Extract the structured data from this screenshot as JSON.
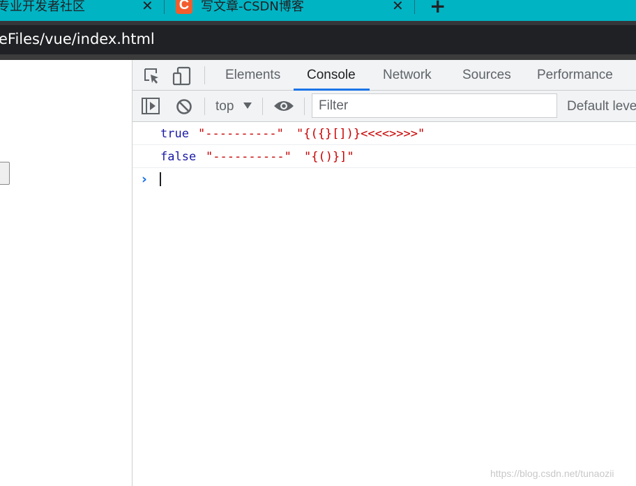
{
  "browser": {
    "tabs": [
      {
        "title": "专业开发者社区",
        "close": "✕"
      },
      {
        "title": "写文章-CSDN博客",
        "favicon": "C",
        "close": "✕"
      }
    ],
    "new_tab": "+",
    "address": "eFiles/vue/index.html"
  },
  "devtools": {
    "tabs": [
      "Elements",
      "Console",
      "Network",
      "Sources",
      "Performance"
    ],
    "active_tab": "Console",
    "toolbar": {
      "context": "top",
      "filter_placeholder": "Filter",
      "levels": "Default levels"
    },
    "console": {
      "logs": [
        {
          "bool": "true",
          "sep": "\"----------\"",
          "value": "\"{({}[])}<<<<>>>>\""
        },
        {
          "bool": "false",
          "sep": "\"----------\"",
          "value": "\"{()}]\""
        }
      ],
      "prompt": "›"
    }
  },
  "watermark": "https://blog.csdn.net/tunaozii",
  "colors": {
    "tabstrip": "#00b4c4",
    "address_bar": "#202124",
    "accent": "#1a73e8",
    "bool": "#1a1aa6",
    "string": "#c80000"
  },
  "icons": [
    "close-icon",
    "csdn-favicon",
    "new-tab-icon",
    "inspect-element-icon",
    "device-toolbar-icon",
    "sidebar-toggle-icon",
    "clear-console-icon",
    "dropdown-arrow-icon",
    "eye-icon"
  ]
}
